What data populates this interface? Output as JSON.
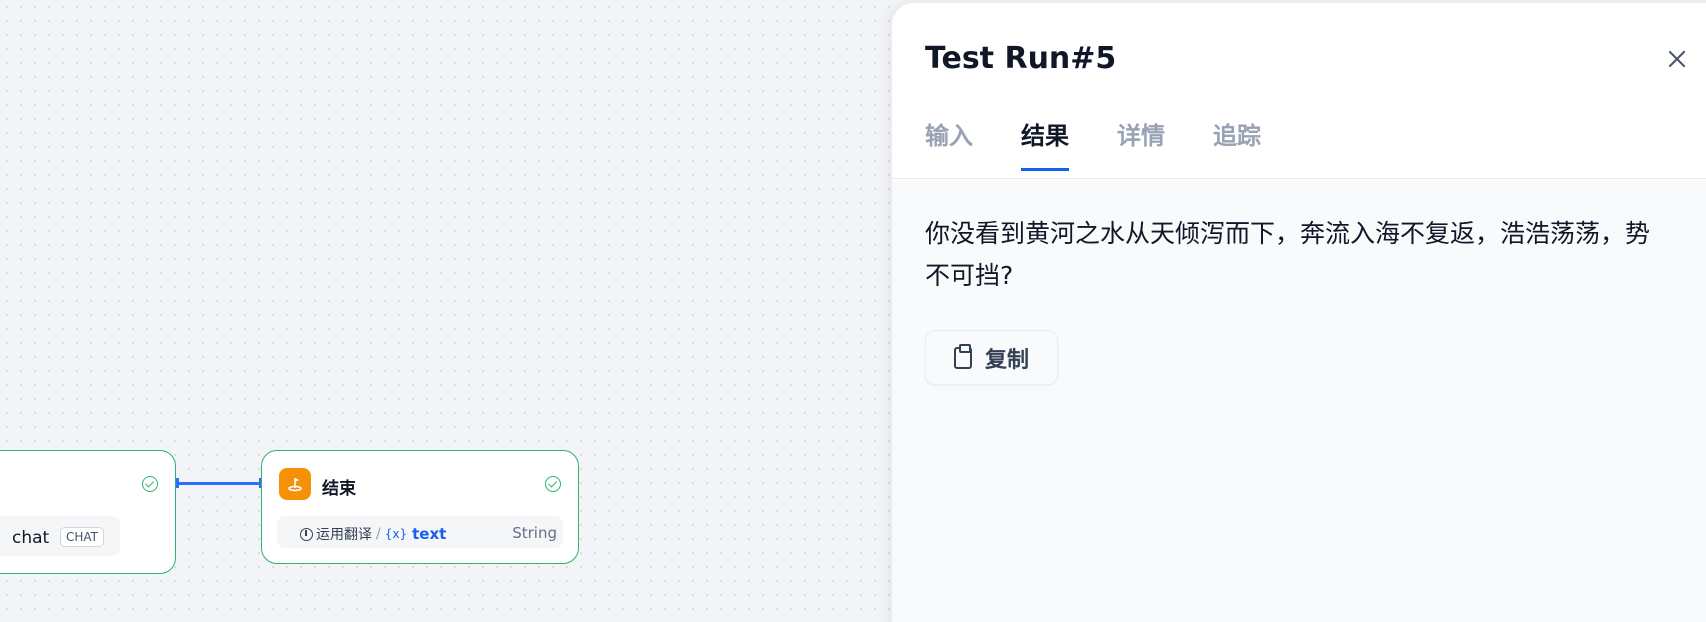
{
  "canvas": {
    "llm_node": {
      "var_text": "chat",
      "badge": "CHAT"
    },
    "end_node": {
      "title": "结束",
      "var_source": "运用翻译",
      "separator": "/",
      "var_icon": "{x}",
      "var_name": "text",
      "var_type": "String"
    }
  },
  "panel": {
    "title": "Test Run#5",
    "tabs": [
      {
        "label": "输入",
        "active": false
      },
      {
        "label": "结果",
        "active": true
      },
      {
        "label": "详情",
        "active": false
      },
      {
        "label": "追踪",
        "active": false
      }
    ],
    "result_text": "你没看到黄河之水从天倾泻而下，奔流入海不复返，浩浩荡荡，势不可挡?",
    "copy_label": "复制"
  },
  "colors": {
    "accent": "#155eef",
    "success": "#2fb36c",
    "end_icon_bg": "#f79009"
  }
}
